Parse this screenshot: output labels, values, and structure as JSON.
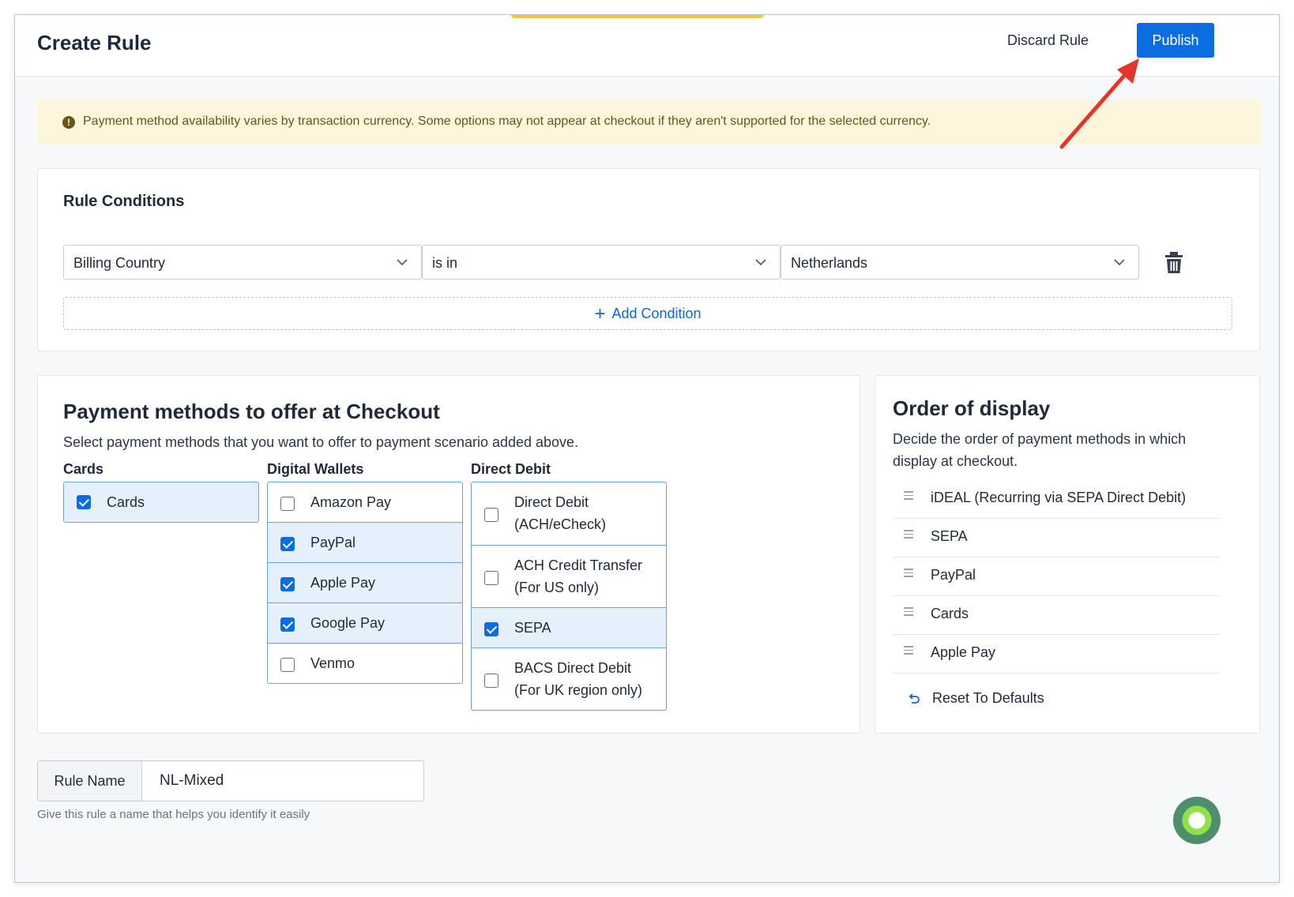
{
  "header": {
    "title": "Create Rule",
    "discard_label": "Discard Rule",
    "publish_label": "Publish"
  },
  "banner": {
    "text": "Payment method availability varies by transaction currency. Some options may not appear at checkout if they aren't supported for the selected currency."
  },
  "conditions": {
    "title": "Rule Conditions",
    "field": "Billing Country",
    "operator": "is in",
    "value": "Netherlands",
    "add_label": "Add Condition"
  },
  "methods": {
    "title": "Payment methods to offer at Checkout",
    "subtitle": "Select payment methods that you want to offer to payment scenario added above.",
    "columns": [
      {
        "title": "Cards",
        "items": [
          {
            "label": "Cards",
            "checked": true
          }
        ]
      },
      {
        "title": "Digital Wallets",
        "items": [
          {
            "label": "Amazon Pay",
            "checked": false
          },
          {
            "label": "PayPal",
            "checked": true
          },
          {
            "label": "Apple Pay",
            "checked": true
          },
          {
            "label": "Google Pay",
            "checked": true
          },
          {
            "label": "Venmo",
            "checked": false
          }
        ]
      },
      {
        "title": "Direct Debit",
        "items": [
          {
            "label": "Direct Debit (ACH/eCheck)",
            "line1": "Direct Debit",
            "line2": "(ACH/eCheck)",
            "checked": false
          },
          {
            "label": "ACH Credit Transfer (For US only)",
            "line1": "ACH Credit Transfer",
            "line2": "(For US only)",
            "checked": false
          },
          {
            "label": "SEPA",
            "checked": true
          },
          {
            "label": "BACS Direct Debit (For UK region only)",
            "line1": "BACS Direct Debit",
            "line2": "(For UK region only)",
            "checked": false
          }
        ]
      }
    ]
  },
  "order": {
    "title": "Order of display",
    "subtitle": "Decide the order of payment methods in which display at checkout.",
    "items": [
      "iDEAL (Recurring via SEPA Direct Debit)",
      "SEPA",
      "PayPal",
      "Cards",
      "Apple Pay"
    ],
    "reset_label": "Reset To Defaults"
  },
  "rule_name": {
    "label": "Rule Name",
    "value": "NL-Mixed",
    "hint": "Give this rule a name that helps you identify it easily"
  },
  "colors": {
    "accent": "#0b6ddf",
    "banner_bg": "#fdf5dc",
    "banner_text": "#6b5418",
    "annotation_arrow": "#e5352b"
  }
}
